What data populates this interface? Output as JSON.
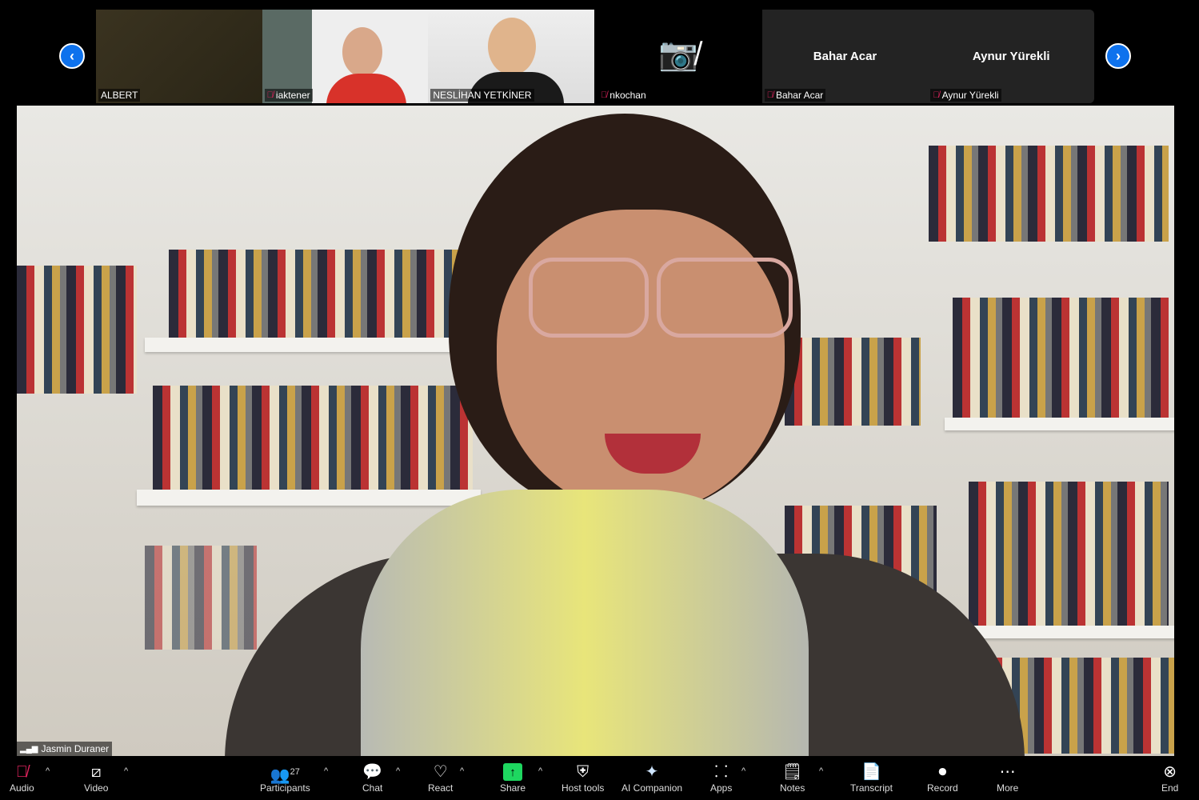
{
  "thumbnails": [
    {
      "name": "ALBERT",
      "type": "video",
      "muted": false
    },
    {
      "name": "iaktener",
      "type": "video",
      "muted": true
    },
    {
      "name": "NESLİHAN YETKİNER",
      "type": "video",
      "muted": false
    },
    {
      "name": "nkochan",
      "type": "camera-off",
      "muted": true
    },
    {
      "name": "Bahar Acar",
      "display": "Bahar Acar",
      "type": "name",
      "muted": true
    },
    {
      "name": "Aynur Yürekli",
      "display": "Aynur Yürekli",
      "type": "name",
      "muted": true
    }
  ],
  "main_speaker": {
    "name": "Jasmin Duraner"
  },
  "toolbar": {
    "audio": "Audio",
    "video": "Video",
    "participants": "Participants",
    "participants_count": "27",
    "chat": "Chat",
    "react": "React",
    "share": "Share",
    "host_tools": "Host tools",
    "ai_companion": "AI Companion",
    "apps": "Apps",
    "notes": "Notes",
    "transcript": "Transcript",
    "record": "Record",
    "more": "More",
    "end": "End"
  },
  "colors": {
    "accent": "#0e72ed",
    "share": "#1ed760",
    "end": "#e0245e",
    "muted": "#e0245e"
  }
}
